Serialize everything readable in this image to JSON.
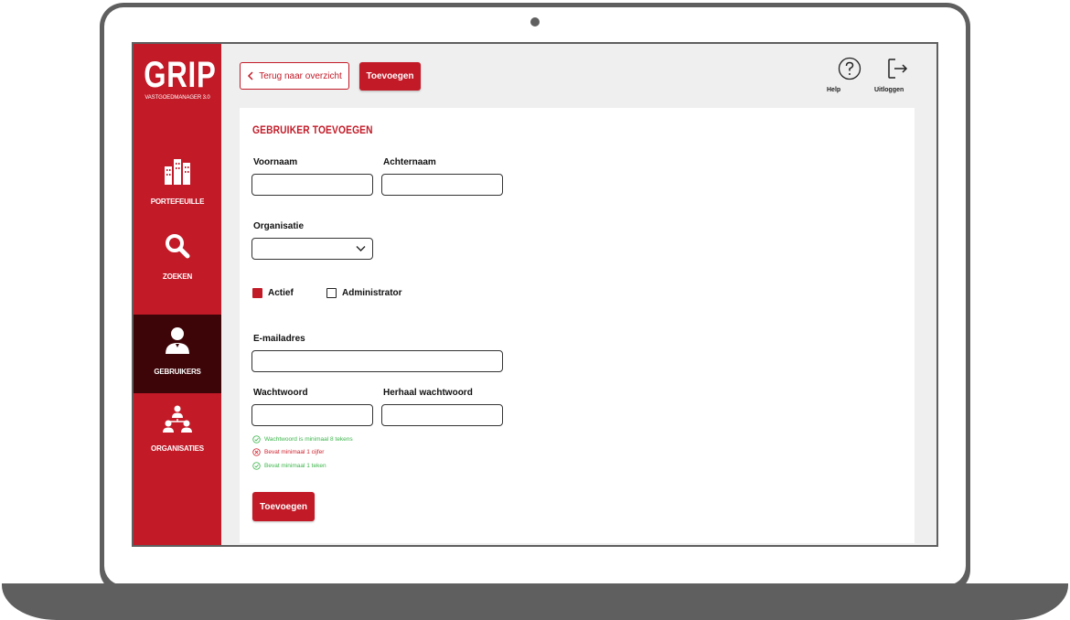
{
  "brand": {
    "name": "GRIP",
    "subtitle": "VASTGOEDMANAGER 3.0"
  },
  "colors": {
    "accent": "#c21a27",
    "nav_active": "#3d0508",
    "success": "#3bb54a",
    "error": "#d0202d"
  },
  "sidebar": {
    "items": [
      {
        "label": "PORTEFEUILLE",
        "icon": "buildings-icon",
        "active": false
      },
      {
        "label": "ZOEKEN",
        "icon": "search-icon",
        "active": false
      },
      {
        "label": "GEBRUIKERS",
        "icon": "user-icon",
        "active": true
      },
      {
        "label": "ORGANISATIES",
        "icon": "org-icon",
        "active": false
      }
    ]
  },
  "topbar": {
    "back_label": "Terug naar overzicht",
    "add_label": "Toevoegen",
    "help_label": "Help",
    "logout_label": "Uitloggen"
  },
  "form": {
    "title": "GEBRUIKER TOEVOEGEN",
    "first_name_label": "Voornaam",
    "first_name_value": "",
    "last_name_label": "Achternaam",
    "last_name_value": "",
    "organisation_label": "Organisatie",
    "organisation_value": "",
    "active_label": "Actief",
    "active_checked": true,
    "admin_label": "Administrator",
    "admin_checked": false,
    "email_label": "E-mailadres",
    "email_value": "",
    "password_label": "Wachtwoord",
    "password_repeat_label": "Herhaal wachtwoord",
    "rules": [
      {
        "text": "Wachtwoord is minimaal 8 tekens",
        "status": "ok"
      },
      {
        "text": "Bevat minimaal 1 cijfer",
        "status": "error"
      },
      {
        "text": "Bevat minimaal 1 teken",
        "status": "ok"
      }
    ],
    "submit_label": "Toevoegen"
  }
}
